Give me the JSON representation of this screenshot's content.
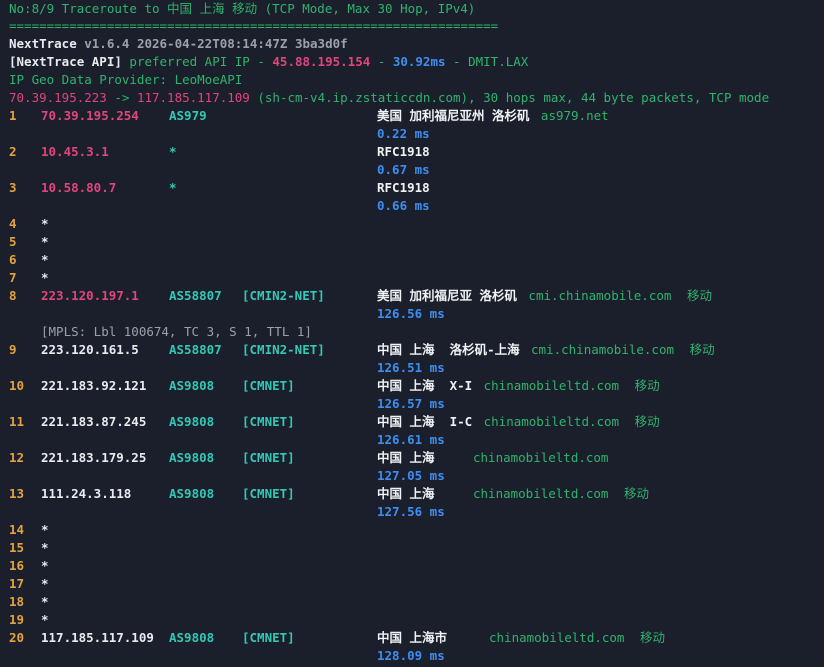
{
  "header": {
    "title": "No:8/9 Traceroute to 中国 上海 移动 (TCP Mode, Max 30 Hop, IPv4)",
    "separator": "=================================================================",
    "nexttrace_name": "NextTrace",
    "nexttrace_meta": " v1.6.4 2026-04-22T08:14:47Z 3ba3d0f",
    "api_label": "[NextTrace API]",
    "api_text": " preferred API IP - ",
    "api_ip": "45.88.195.154",
    "api_dash": " - ",
    "api_ms": "30.92ms",
    "api_node": " - DMIT.LAX",
    "geo_provider": "IP Geo Data Provider: LeoMoeAPI",
    "route_src": "70.39.195.223",
    "route_arrow": " -> ",
    "route_dst": "117.185.117.109",
    "route_rest": " (sh-cm-v4.ip.zstaticcdn.com), 30 hops max, 44 byte packets, TCP mode"
  },
  "colors": {
    "background": "#1b1f2b",
    "green": "#2fb36d",
    "pink": "#e0457b",
    "blue": "#3d8ef0",
    "orange": "#e6a23c",
    "teal": "#34c8b6"
  },
  "hops": [
    {
      "n": "1",
      "ip": "70.39.195.254",
      "ip_color": "pink",
      "as": "AS979",
      "tag": "",
      "geo": "美国 加利福尼亚州 洛杉矶",
      "host": "as979.net",
      "carrier": "",
      "ms": "0.22 ms"
    },
    {
      "n": "2",
      "ip": "10.45.3.1",
      "ip_color": "pink",
      "as": "*",
      "tag": "",
      "geo": "RFC1918",
      "host": "",
      "carrier": "",
      "ms": "0.67 ms"
    },
    {
      "n": "3",
      "ip": "10.58.80.7",
      "ip_color": "pink",
      "as": "*",
      "tag": "",
      "geo": "RFC1918",
      "host": "",
      "carrier": "",
      "ms": "0.66 ms"
    },
    {
      "n": "4",
      "ip": "*"
    },
    {
      "n": "5",
      "ip": "*"
    },
    {
      "n": "6",
      "ip": "*"
    },
    {
      "n": "7",
      "ip": "*"
    },
    {
      "n": "8",
      "ip": "223.120.197.1",
      "ip_color": "pink",
      "as": "AS58807",
      "tag": "[CMIN2-NET]",
      "geo": "美国 加利福尼亚 洛杉矶",
      "host": "cmi.chinamobile.com",
      "carrier": "移动",
      "ms": "126.56 ms",
      "mpls": "[MPLS: Lbl 100674, TC 3, S 1, TTL 1]"
    },
    {
      "n": "9",
      "ip": "223.120.161.5",
      "ip_color": "white",
      "as": "AS58807",
      "tag": "[CMIN2-NET]",
      "geo": "中国 上海  洛杉矶-上海",
      "host": "cmi.chinamobile.com",
      "carrier": "移动",
      "ms": "126.51 ms"
    },
    {
      "n": "10",
      "ip": "221.183.92.121",
      "ip_color": "white",
      "as": "AS9808",
      "tag": "[CMNET]",
      "geo": "中国 上海  X-I",
      "host": "chinamobileltd.com",
      "carrier": "移动",
      "ms": "126.57 ms"
    },
    {
      "n": "11",
      "ip": "221.183.87.245",
      "ip_color": "white",
      "as": "AS9808",
      "tag": "[CMNET]",
      "geo": "中国 上海  I-C",
      "host": "chinamobileltd.com",
      "carrier": "移动",
      "ms": "126.61 ms"
    },
    {
      "n": "12",
      "ip": "221.183.179.25",
      "ip_color": "white",
      "as": "AS9808",
      "tag": "[CMNET]",
      "geo": "中国 上海",
      "host": "chinamobileltd.com",
      "carrier": "",
      "ms": "127.05 ms"
    },
    {
      "n": "13",
      "ip": "111.24.3.118",
      "ip_color": "white",
      "as": "AS9808",
      "tag": "[CMNET]",
      "geo": "中国 上海",
      "host": "chinamobileltd.com",
      "carrier": "移动",
      "ms": "127.56 ms"
    },
    {
      "n": "14",
      "ip": "*"
    },
    {
      "n": "15",
      "ip": "*"
    },
    {
      "n": "16",
      "ip": "*"
    },
    {
      "n": "17",
      "ip": "*"
    },
    {
      "n": "18",
      "ip": "*"
    },
    {
      "n": "19",
      "ip": "*"
    },
    {
      "n": "20",
      "ip": "117.185.117.109",
      "ip_color": "white",
      "as": "AS9808",
      "tag": "[CMNET]",
      "geo": "中国 上海市",
      "host": "chinamobileltd.com",
      "carrier": "移动",
      "ms": "128.09 ms"
    }
  ]
}
